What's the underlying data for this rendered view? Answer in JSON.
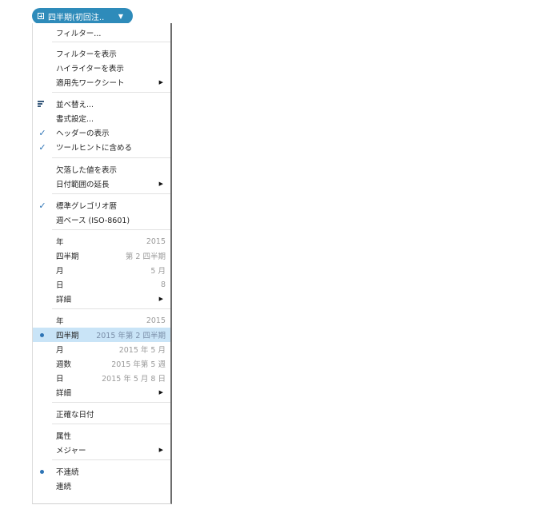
{
  "pill": {
    "label": "四半期(初回注..",
    "caret": "▼"
  },
  "menu": {
    "filter": "フィルター...",
    "show_filter": "フィルターを表示",
    "show_highlighter": "ハイライターを表示",
    "apply_worksheets": "適用先ワークシート",
    "sort": "並べ替え...",
    "format": "書式設定...",
    "show_header": "ヘッダーの表示",
    "include_tooltip": "ツールヒントに含める",
    "show_missing": "欠落した値を表示",
    "extend_date_range": "日付範囲の延長",
    "standard_gregorian": "標準グレゴリオ暦",
    "week_based": "週ベース (ISO-8601)",
    "date_part": {
      "year": {
        "label": "年",
        "value": "2015"
      },
      "quarter": {
        "label": "四半期",
        "value": "第 2 四半期"
      },
      "month": {
        "label": "月",
        "value": "5 月"
      },
      "day": {
        "label": "日",
        "value": "8"
      },
      "more": "詳細"
    },
    "date_value": {
      "year": {
        "label": "年",
        "value": "2015"
      },
      "quarter": {
        "label": "四半期",
        "value": "2015 年第 2 四半期"
      },
      "month": {
        "label": "月",
        "value": "2015 年 5 月"
      },
      "week": {
        "label": "週数",
        "value": "2015 年第 5 週"
      },
      "day": {
        "label": "日",
        "value": "2015 年 5 月 8 日"
      },
      "more": "詳細"
    },
    "exact_date": "正確な日付",
    "attribute": "属性",
    "measure": "メジャー",
    "discrete": "不連続",
    "continuous": "連続"
  }
}
